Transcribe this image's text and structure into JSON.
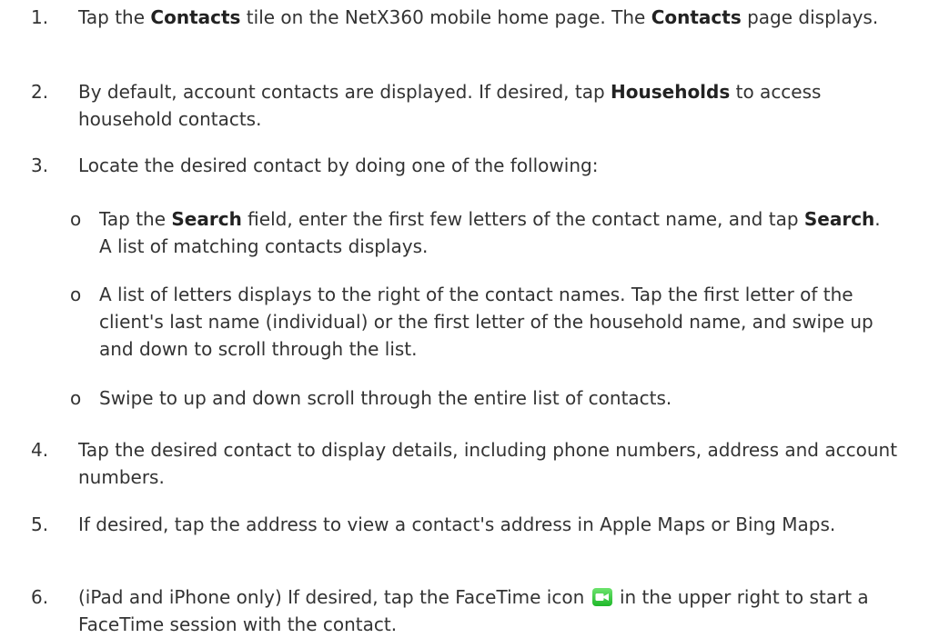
{
  "steps": [
    {
      "num": "1.",
      "parts": [
        "Tap the ",
        "Contacts",
        " tile on the NetX360 mobile home page. The ",
        "Contacts",
        " page displays."
      ]
    },
    {
      "num": "2.",
      "parts": [
        "By default, account contacts are displayed. If desired, tap ",
        "Households",
        " to access household contacts."
      ]
    },
    {
      "num": "3.",
      "text": "Locate the desired contact by doing one of the following:",
      "subs": [
        {
          "bullet": "o",
          "parts": [
            "Tap the ",
            "Search",
            " field, enter the first few letters of the contact name, and tap ",
            "Search",
            ". A list of matching contacts displays."
          ]
        },
        {
          "bullet": "o",
          "text": "A list of letters displays to the right of the contact names. Tap the first letter of the client's last name (individual) or the first letter of the household name, and swipe up and down to scroll through the list."
        },
        {
          "bullet": "o",
          "text": "Swipe to up and down scroll through the entire list of contacts."
        }
      ]
    },
    {
      "num": "4.",
      "text": "Tap the desired contact to display details, including phone numbers, address and account numbers."
    },
    {
      "num": "5.",
      "text": "If desired, tap the address to view a contact's address in Apple Maps or Bing Maps."
    },
    {
      "num": "6.",
      "parts": [
        "(iPad and iPhone only) If desired, tap the FaceTime icon ",
        " in the upper right to start a FaceTime session with the contact."
      ]
    }
  ],
  "icons": {
    "facetime": "facetime-video-camera-icon",
    "facetime_color": "#2ecc40"
  }
}
